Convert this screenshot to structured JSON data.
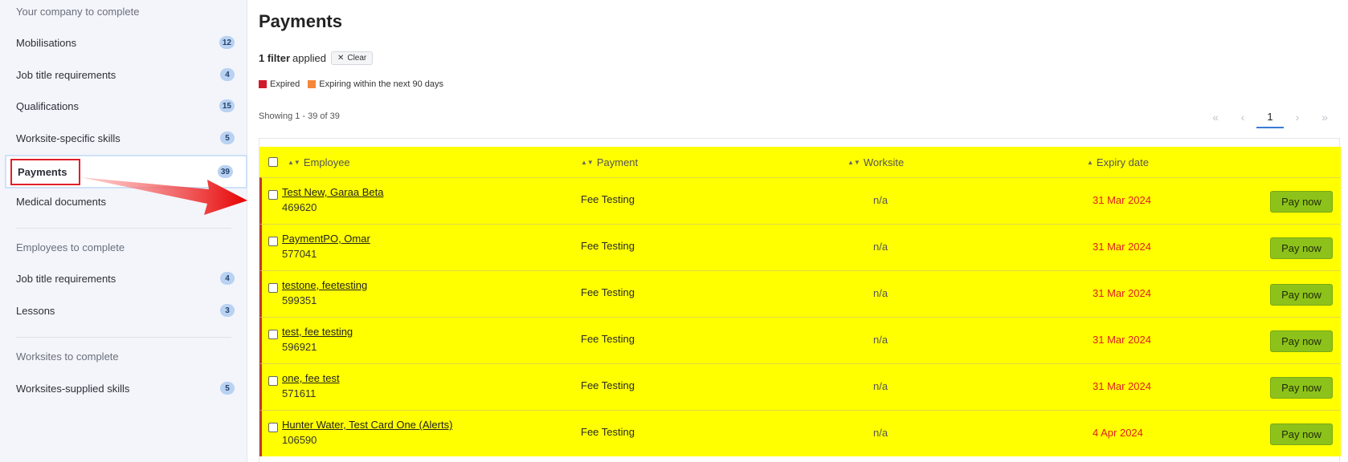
{
  "sidebar": {
    "company_heading": "Your company to complete",
    "company_items": [
      {
        "label": "Mobilisations",
        "count": "12"
      },
      {
        "label": "Job title requirements",
        "count": "4"
      },
      {
        "label": "Qualifications",
        "count": "15"
      },
      {
        "label": "Worksite-specific skills",
        "count": "5"
      },
      {
        "label": "Payments",
        "count": "39"
      },
      {
        "label": "Medical documents",
        "count": ""
      }
    ],
    "employees_heading": "Employees to complete",
    "employee_items": [
      {
        "label": "Job title requirements",
        "count": "4"
      },
      {
        "label": "Lessons",
        "count": "3"
      }
    ],
    "worksites_heading": "Worksites to complete",
    "worksite_items": [
      {
        "label": "Worksites-supplied skills",
        "count": "5"
      }
    ]
  },
  "main": {
    "title": "Payments",
    "filter_count": "1 filter",
    "filter_applied": "applied",
    "clear_label": "Clear",
    "legend": [
      {
        "label": "Expired",
        "color": "#d0192b"
      },
      {
        "label": "Expiring within the next 90 days",
        "color": "#f5873a"
      }
    ],
    "showing": "Showing 1 - 39 of 39",
    "pager": {
      "first": "«",
      "prev": "‹",
      "current": "1",
      "next": "›",
      "last": "»"
    },
    "columns": {
      "employee": "Employee",
      "payment": "Payment",
      "worksite": "Worksite",
      "expiry": "Expiry date"
    },
    "rows": [
      {
        "name": "Test New, Garaa Beta",
        "id": "469620",
        "payment": "Fee Testing",
        "worksite": "n/a",
        "expiry": "31 Mar 2024",
        "action": "Pay now"
      },
      {
        "name": "PaymentPO, Omar",
        "id": "577041",
        "payment": "Fee Testing",
        "worksite": "n/a",
        "expiry": "31 Mar 2024",
        "action": "Pay now"
      },
      {
        "name": "testone, feetesting",
        "id": "599351",
        "payment": "Fee Testing",
        "worksite": "n/a",
        "expiry": "31 Mar 2024",
        "action": "Pay now"
      },
      {
        "name": "test, fee testing",
        "id": "596921",
        "payment": "Fee Testing",
        "worksite": "n/a",
        "expiry": "31 Mar 2024",
        "action": "Pay now"
      },
      {
        "name": "one, fee test",
        "id": "571611",
        "payment": "Fee Testing",
        "worksite": "n/a",
        "expiry": "31 Mar 2024",
        "action": "Pay now"
      },
      {
        "name": "Hunter Water, Test Card One (Alerts)",
        "id": "106590",
        "payment": "Fee Testing",
        "worksite": "n/a",
        "expiry": "4 Apr 2024",
        "action": "Pay now"
      }
    ]
  },
  "colors": {
    "highlight": "#ffff00",
    "expired_text": "#e02020",
    "pay_button": "#8dc21a",
    "annotation": "#e0202a"
  }
}
